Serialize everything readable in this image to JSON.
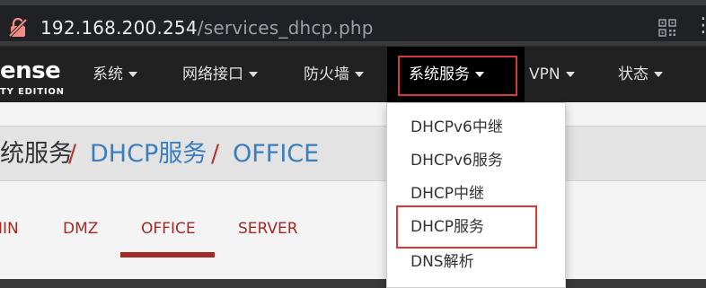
{
  "browser": {
    "url_host": "192.168.200.254",
    "url_path": "/services_dhcp.php"
  },
  "brand": {
    "line1": "ense",
    "line2": "TY EDITION"
  },
  "navbar": {
    "items": [
      {
        "label": "系统"
      },
      {
        "label": "网络接口"
      },
      {
        "label": "防火墙"
      },
      {
        "label": "系统服务",
        "active": true
      },
      {
        "label": "VPN"
      },
      {
        "label": "状态"
      }
    ]
  },
  "breadcrumb": {
    "part1": "统服务",
    "sep1": "/",
    "part2": "DHCP服务",
    "sep2": "/",
    "part3": "OFFICE"
  },
  "tabs": {
    "items": [
      {
        "label": "IIN"
      },
      {
        "label": "DMZ"
      },
      {
        "label": "OFFICE",
        "active": true
      },
      {
        "label": "SERVER"
      }
    ]
  },
  "dropdown": {
    "items": [
      {
        "label": "DHCPv6中继"
      },
      {
        "label": "DHCPv6服务"
      },
      {
        "label": "DHCP中继"
      },
      {
        "label": "DHCP服务",
        "highlighted": true
      },
      {
        "label": "DNS解析"
      }
    ]
  },
  "colors": {
    "navbar_bg": "#212121",
    "highlight_box": "#d9383a",
    "link_blue": "#3a7ebf",
    "tab_red": "#a42a26"
  },
  "icons": {
    "lock": "not-secure-lock-icon",
    "qr": "qr-code-icon",
    "more": "more-vert-icon"
  }
}
